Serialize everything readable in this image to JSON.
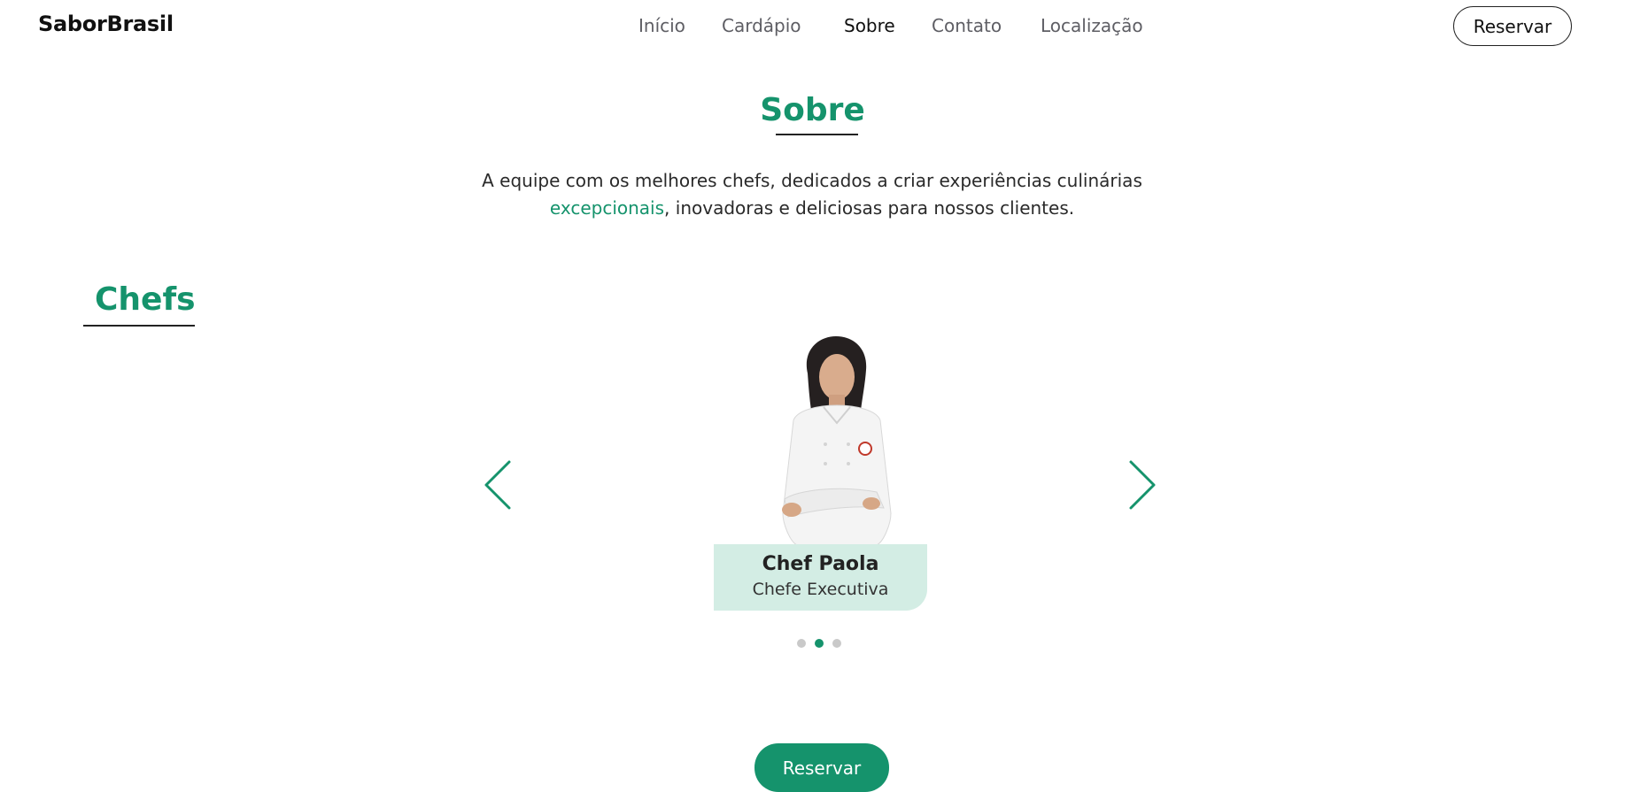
{
  "brand": "SaborBrasil",
  "nav": {
    "items": [
      {
        "label": "Início"
      },
      {
        "label": "Cardápio"
      },
      {
        "label": "Sobre"
      },
      {
        "label": "Contato"
      },
      {
        "label": "Localização"
      }
    ],
    "active": "Sobre",
    "reserve_label": "Reservar"
  },
  "about": {
    "title": "Sobre",
    "text_before": "A equipe com os melhores chefs, dedicados a criar experiências culinárias ",
    "text_accent": "excepcionais",
    "text_after": ", inovadoras e deliciosas para nossos clientes."
  },
  "chefs": {
    "title": "Chefs",
    "current": {
      "name": "Chef Paola",
      "role": "Chefe Executiva"
    },
    "total_slides": 3,
    "active_slide": 2
  },
  "cta": {
    "label": "Reservar"
  },
  "colors": {
    "accent": "#15936c",
    "card_bg": "#d3ede4",
    "nav_text": "#5e5e64"
  }
}
